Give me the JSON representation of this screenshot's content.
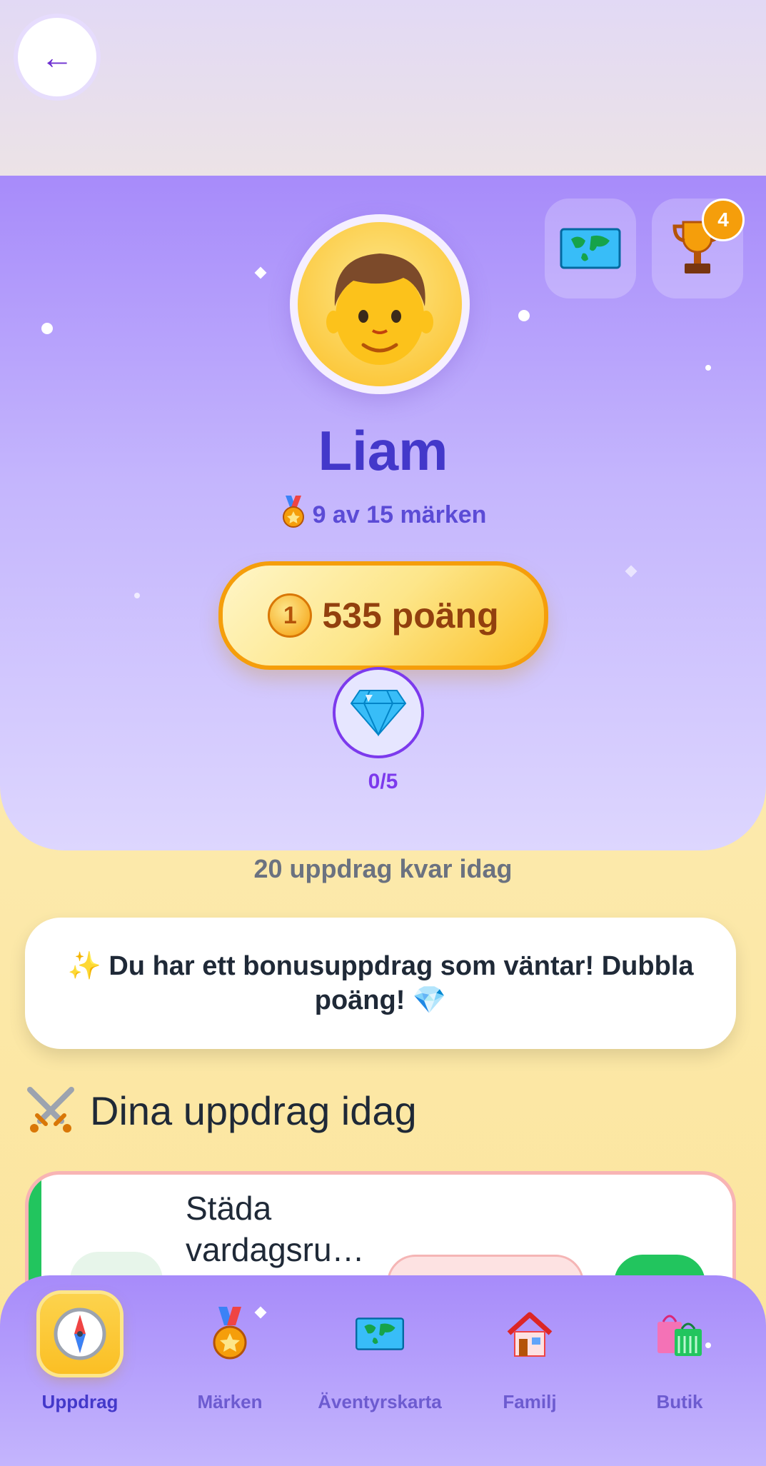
{
  "header": {
    "back_label": "←"
  },
  "hero": {
    "map_button": "map-icon",
    "trophy_button": "trophy-icon",
    "trophy_count": "4",
    "avatar": "boy-avatar",
    "name": "Liam",
    "badges_text": "9 av 15 märken",
    "points_text": "535 poäng",
    "gem_progress": "0/5"
  },
  "missions_left": "20 uppdrag kvar idag",
  "bonus_message": "✨ Du har ett bonusuppdrag som väntar! Dubbla poäng! 💎",
  "section_title": "Dina uppdrag idag",
  "task": {
    "title": "Städa vardagsru…"
  },
  "nav": {
    "items": [
      {
        "label": "Uppdrag",
        "icon": "compass-icon"
      },
      {
        "label": "Märken",
        "icon": "medal-icon"
      },
      {
        "label": "Äventyrskarta",
        "icon": "map-icon"
      },
      {
        "label": "Familj",
        "icon": "house-icon"
      },
      {
        "label": "Butik",
        "icon": "shopping-bags-icon"
      }
    ]
  },
  "colors": {
    "accent": "#4338ca",
    "gold": "#f59e0b",
    "task_done": "#22c55e"
  }
}
